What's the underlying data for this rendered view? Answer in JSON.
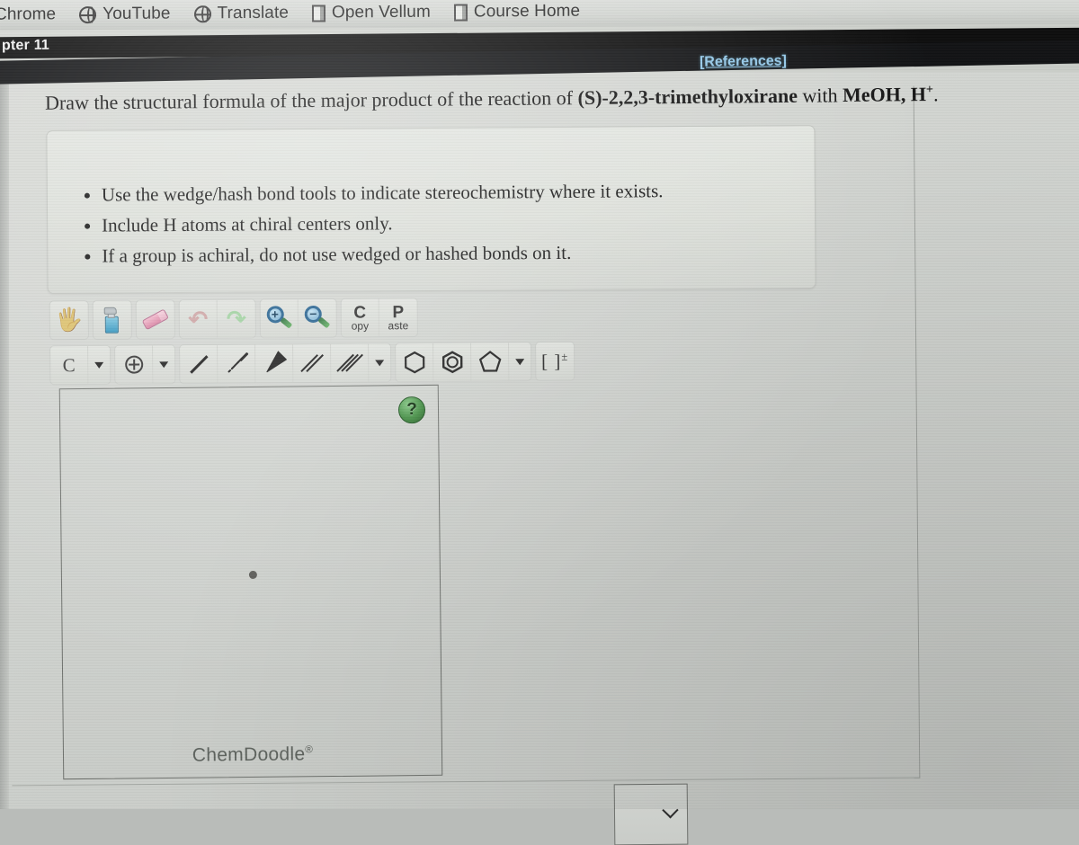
{
  "browser": {
    "bookmarks": [
      {
        "label": "Chrome",
        "icon": "none"
      },
      {
        "label": "YouTube",
        "icon": "globe-icon"
      },
      {
        "label": "Translate",
        "icon": "globe-icon"
      },
      {
        "label": "Open Vellum",
        "icon": "document-icon"
      },
      {
        "label": "Course Home",
        "icon": "document-icon"
      }
    ]
  },
  "header": {
    "chapter_title": "pter 11",
    "references_label": "[References]",
    "references_color": "#93c8e8",
    "bar_color": "#0d0d0d"
  },
  "question": {
    "prefix": "Draw the structural formula of the major product of the reaction of ",
    "reagent_stereo": "(S)",
    "reagent_dash": "-",
    "reagent_name": "2,2,3-trimethyloxirane",
    "middle": " with ",
    "conditions": "MeOH, H",
    "conditions_sup": "+",
    "suffix": "."
  },
  "instructions": {
    "items": [
      "Use the wedge/hash bond tools to indicate stereochemistry where it exists.",
      "Include H atoms at chiral centers only.",
      "If a group is achiral, do not use wedged or hashed bonds on it."
    ]
  },
  "toolbar_row1": [
    {
      "name": "pan-tool",
      "icon": "hand-icon",
      "label": ""
    },
    {
      "name": "clear-tool",
      "icon": "spray-bottle-icon",
      "label": ""
    },
    {
      "name": "erase-tool",
      "icon": "eraser-icon",
      "label": ""
    },
    {
      "name": "undo-button",
      "icon": "undo-arrow-icon",
      "label": "↶"
    },
    {
      "name": "redo-button",
      "icon": "redo-arrow-icon",
      "label": "↷"
    },
    {
      "name": "zoom-in-button",
      "icon": "magnifier-plus-icon",
      "label": "+"
    },
    {
      "name": "zoom-out-button",
      "icon": "magnifier-minus-icon",
      "label": "−"
    },
    {
      "name": "copy-button",
      "icon": "copy-icon",
      "label_big": "C",
      "label_small": "opy"
    },
    {
      "name": "paste-button",
      "icon": "paste-icon",
      "label_big": "P",
      "label_small": "aste"
    }
  ],
  "toolbar_row2": {
    "element_tool": {
      "label": "C",
      "name": "element-carbon-tool"
    },
    "charge_tool": {
      "label": "⊕",
      "name": "charge-tool"
    },
    "bond_tools": [
      {
        "name": "single-bond-tool",
        "type": "single"
      },
      {
        "name": "hashed-wedge-bond-tool",
        "type": "hash"
      },
      {
        "name": "solid-wedge-bond-tool",
        "type": "wedge"
      },
      {
        "name": "double-bond-tool",
        "type": "double"
      },
      {
        "name": "triple-bond-tool",
        "type": "triple"
      }
    ],
    "ring_tools": [
      {
        "name": "cyclohexane-ring-tool",
        "type": "hexagon"
      },
      {
        "name": "benzene-ring-tool",
        "type": "benzene"
      },
      {
        "name": "cyclopentane-ring-tool",
        "type": "pentagon"
      }
    ],
    "bracket_tool": {
      "label": "[ ]",
      "sup": "±",
      "name": "bracket-charge-tool"
    }
  },
  "canvas": {
    "help_label": "?",
    "watermark": "ChemDoodle",
    "watermark_sup": "®",
    "has_atom_dot": true
  },
  "expander": {
    "name": "answer-expander",
    "chevron": "chevron-down-icon"
  }
}
